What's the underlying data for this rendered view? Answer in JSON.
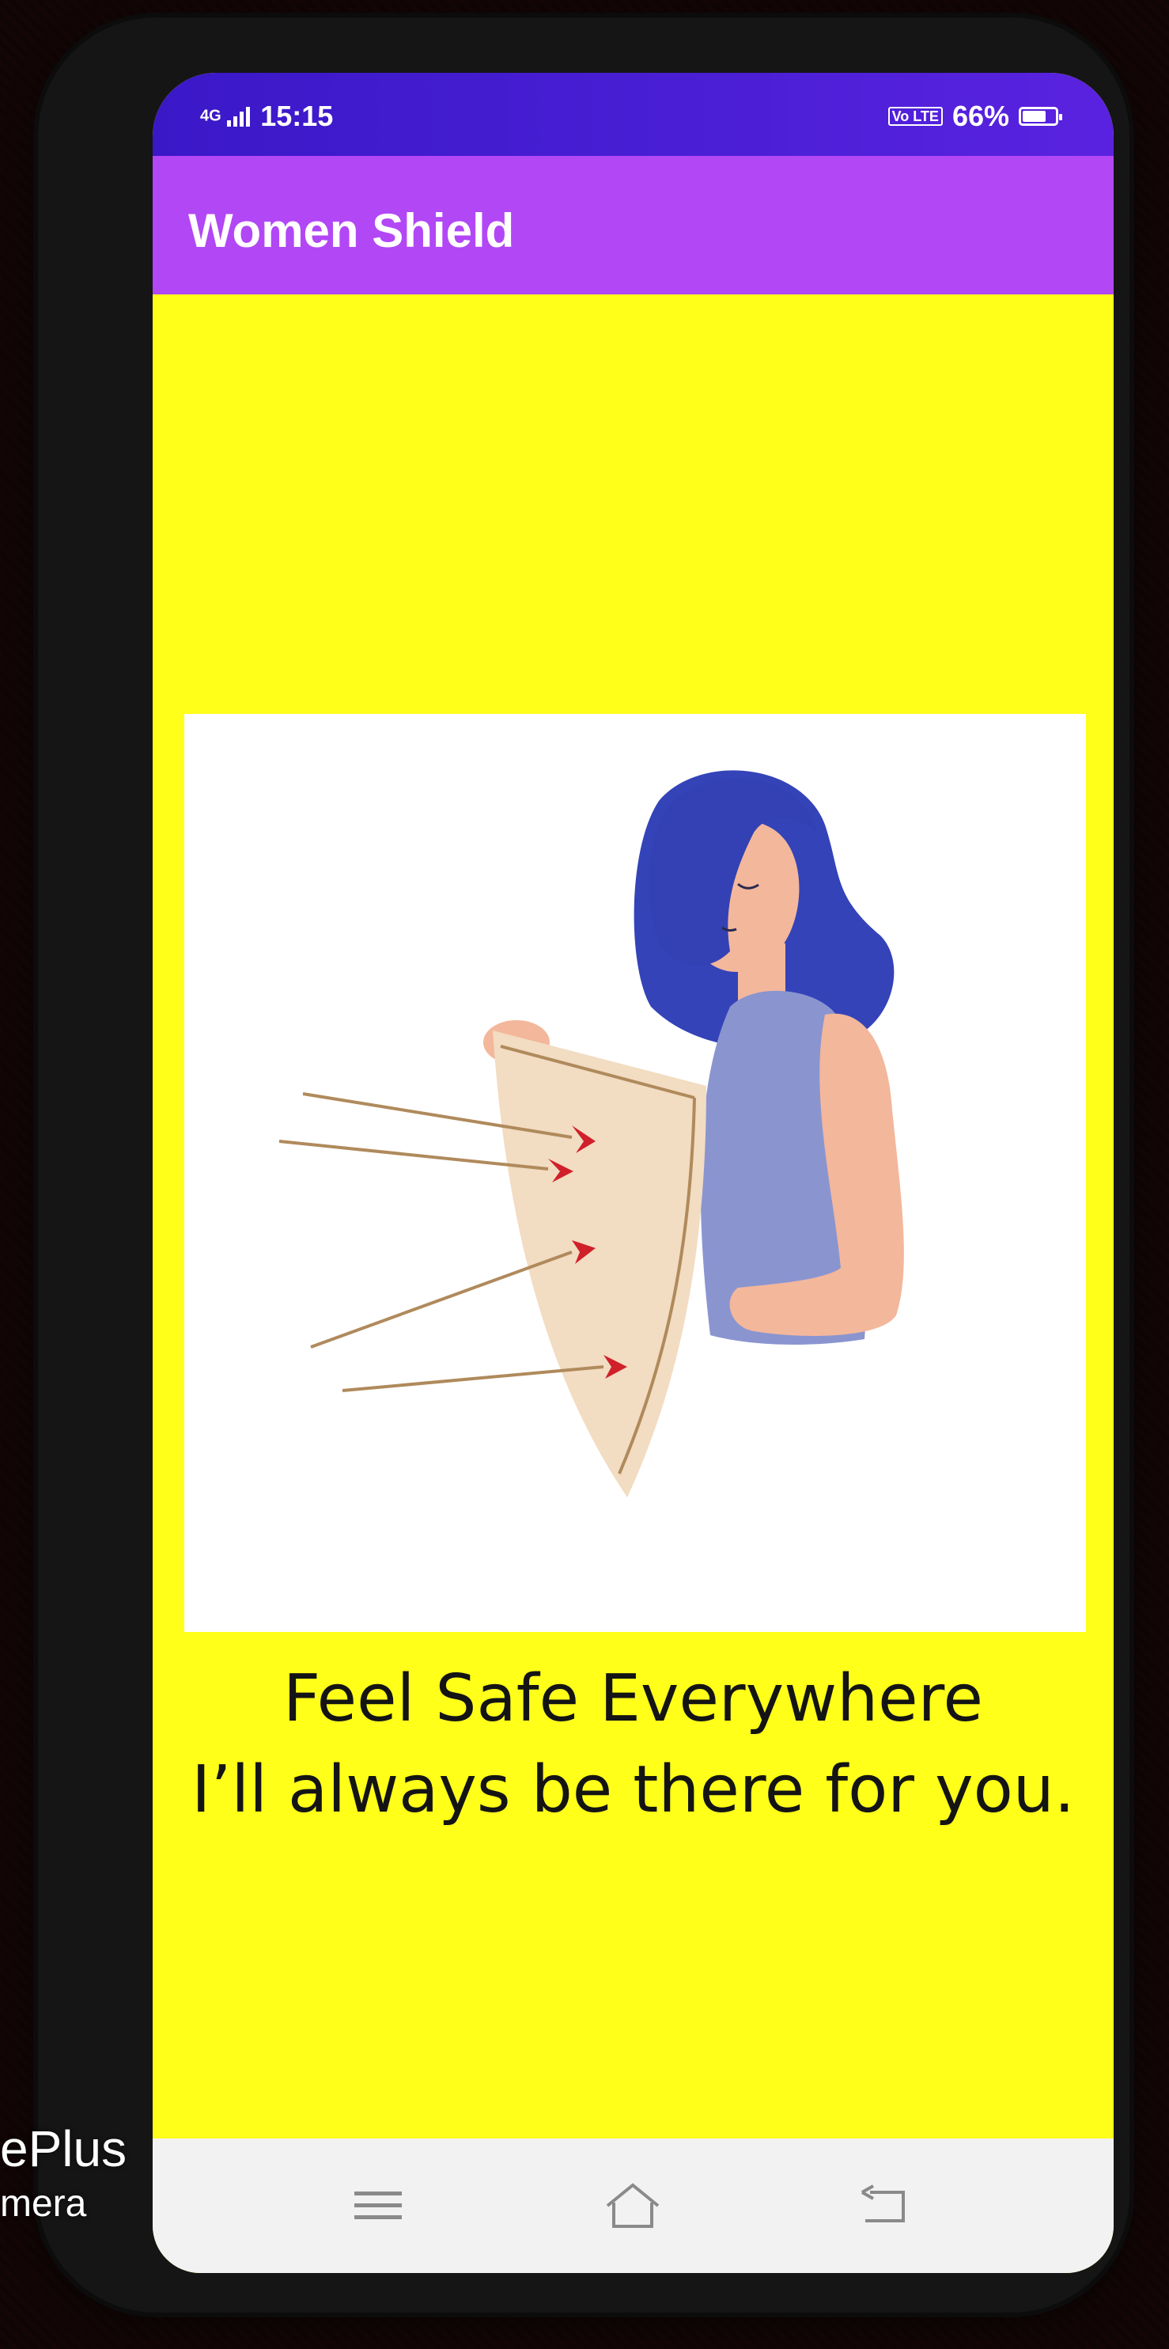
{
  "status_bar": {
    "network": "4G",
    "time": "15:15",
    "volte": "Vo LTE",
    "battery": "66%",
    "battery_level": 0.66
  },
  "app_bar": {
    "title": "Women Shield"
  },
  "illustration": {
    "icon": "woman-with-shield-illustration"
  },
  "tagline": {
    "line1": "Feel Safe Everywhere",
    "line2": "I’ll always be there for you."
  },
  "nav_bar": {
    "menu_icon": "menu-icon",
    "home_icon": "home-icon",
    "back_icon": "back-icon"
  },
  "camera_watermark": {
    "line1": "ePlus",
    "line2": "mera"
  },
  "colors": {
    "status_bar": "#4b1fd6",
    "app_bar": "#b247f6",
    "background": "#ffff1a",
    "card": "#ffffff"
  }
}
